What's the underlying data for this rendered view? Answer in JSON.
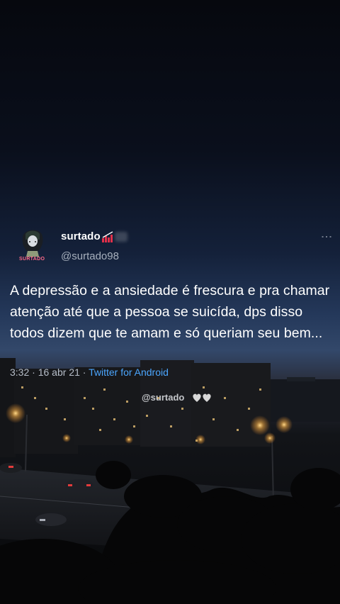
{
  "tweet": {
    "display_name": "surtado",
    "handle": "@surtado98",
    "avatar_label": "SURTADO",
    "text": "A depressão e a ansiedade é frescura e pra chamar atenção até que a pessoa se suicída, dps disso todos dizem que te amam e só queriam seu bem...",
    "time": "3:32",
    "date": "16 abr 21",
    "separator": " · ",
    "source": "Twitter for Android"
  },
  "watermark": "@surtado",
  "icons": {
    "name_badge": "equalizer-icon",
    "more": "more-vertical-icon",
    "watermark_hearts": "hearts-icon"
  },
  "colors": {
    "text": "#ffffff",
    "handle": "#a7b0bd",
    "link": "#4ba6ff",
    "badge": "#e0304a"
  }
}
